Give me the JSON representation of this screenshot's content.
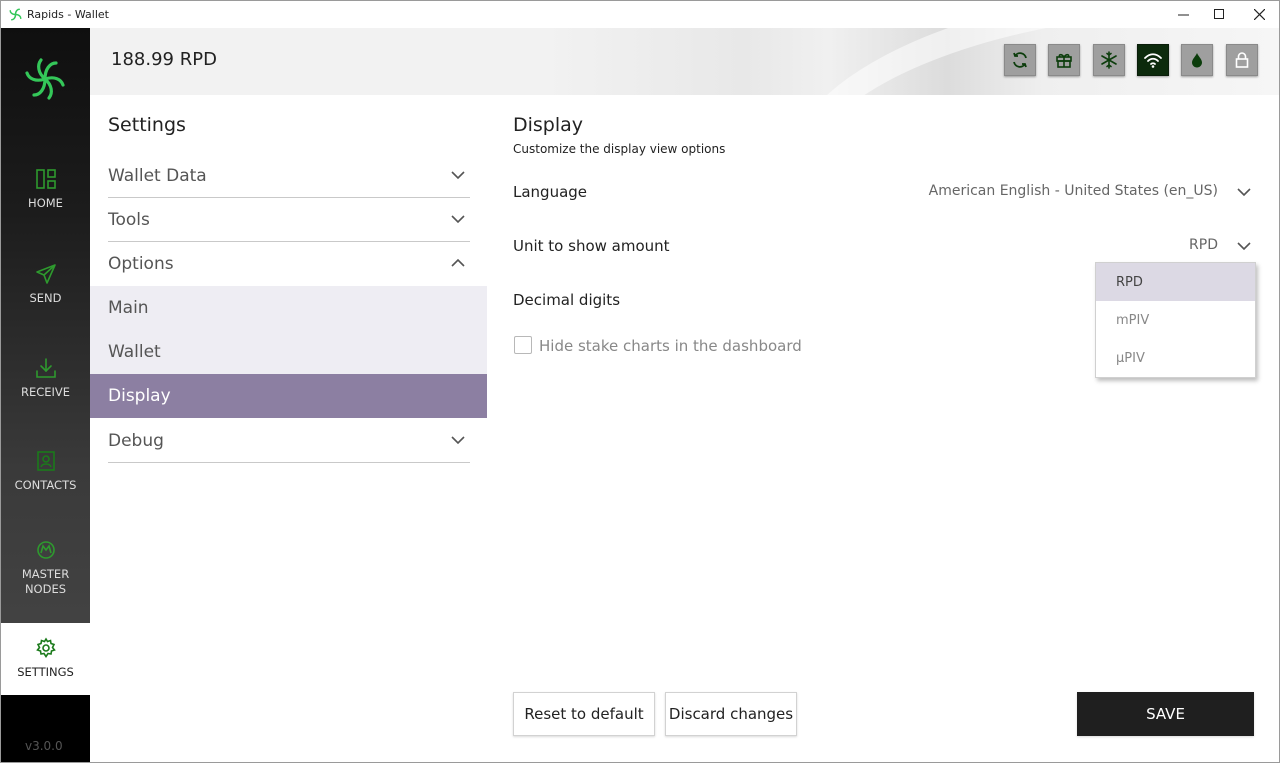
{
  "window": {
    "title": "Rapids - Wallet"
  },
  "colors": {
    "accent": "#8c7fa2",
    "brand_green": "#34c759",
    "nav_icon_green": "#1b7a1b",
    "save_bg": "#1f1f1f"
  },
  "nav": {
    "items": [
      {
        "label": "HOME",
        "icon": "home-icon"
      },
      {
        "label": "SEND",
        "icon": "send-icon"
      },
      {
        "label": "RECEIVE",
        "icon": "receive-icon"
      },
      {
        "label": "CONTACTS",
        "icon": "contacts-icon"
      },
      {
        "label_line1": "MASTER",
        "label_line2": "NODES",
        "icon": "masternodes-icon"
      },
      {
        "label": "SETTINGS",
        "icon": "gear-icon"
      }
    ],
    "version": "v3.0.0"
  },
  "header": {
    "balance": "188.99 RPD",
    "buttons": [
      "sync-icon",
      "gift-icon",
      "snowflake-icon",
      "wifi-icon",
      "tor-icon",
      "lock-icon"
    ]
  },
  "settings_menu": {
    "title": "Settings",
    "sections": [
      {
        "label": "Wallet Data",
        "expanded": false
      },
      {
        "label": "Tools",
        "expanded": false
      },
      {
        "label": "Options",
        "expanded": true
      }
    ],
    "options_sub": [
      "Main",
      "Wallet",
      "Display"
    ],
    "active_sub": "Display",
    "after": [
      {
        "label": "Debug",
        "expanded": false
      }
    ]
  },
  "content": {
    "title": "Display",
    "subtitle": "Customize the display view options",
    "language_label": "Language",
    "language_value": "American English - United States (en_US)",
    "unit_label": "Unit to show amount",
    "unit_value": "RPD",
    "decimal_label": "Decimal digits",
    "hide_stake_label": "Hide stake charts in the dashboard",
    "hide_stake_checked": false
  },
  "unit_dropdown": {
    "options": [
      "RPD",
      "mPIV",
      "µPIV"
    ],
    "selected": "RPD"
  },
  "buttons": {
    "reset": "Reset to default",
    "discard": "Discard changes",
    "save": "SAVE"
  }
}
